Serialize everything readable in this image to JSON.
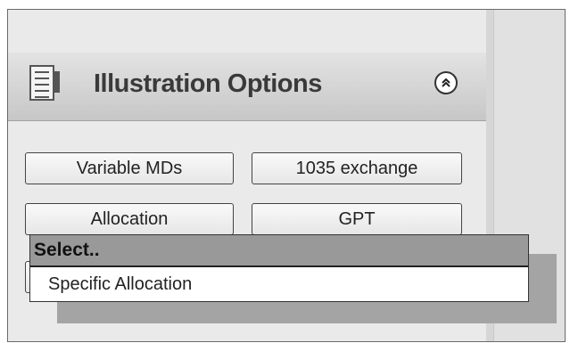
{
  "panel": {
    "title": "Illustration Options",
    "collapse_glyph": "⌃⌃",
    "icon": "document-icon"
  },
  "buttons": {
    "variable_mds": "Variable MDs",
    "exchange_1035": "1035 exchange",
    "allocation": "Allocation",
    "gpt": "GPT"
  },
  "dropdown": {
    "selected": "Select..",
    "options": [
      "Specific Allocation"
    ]
  }
}
